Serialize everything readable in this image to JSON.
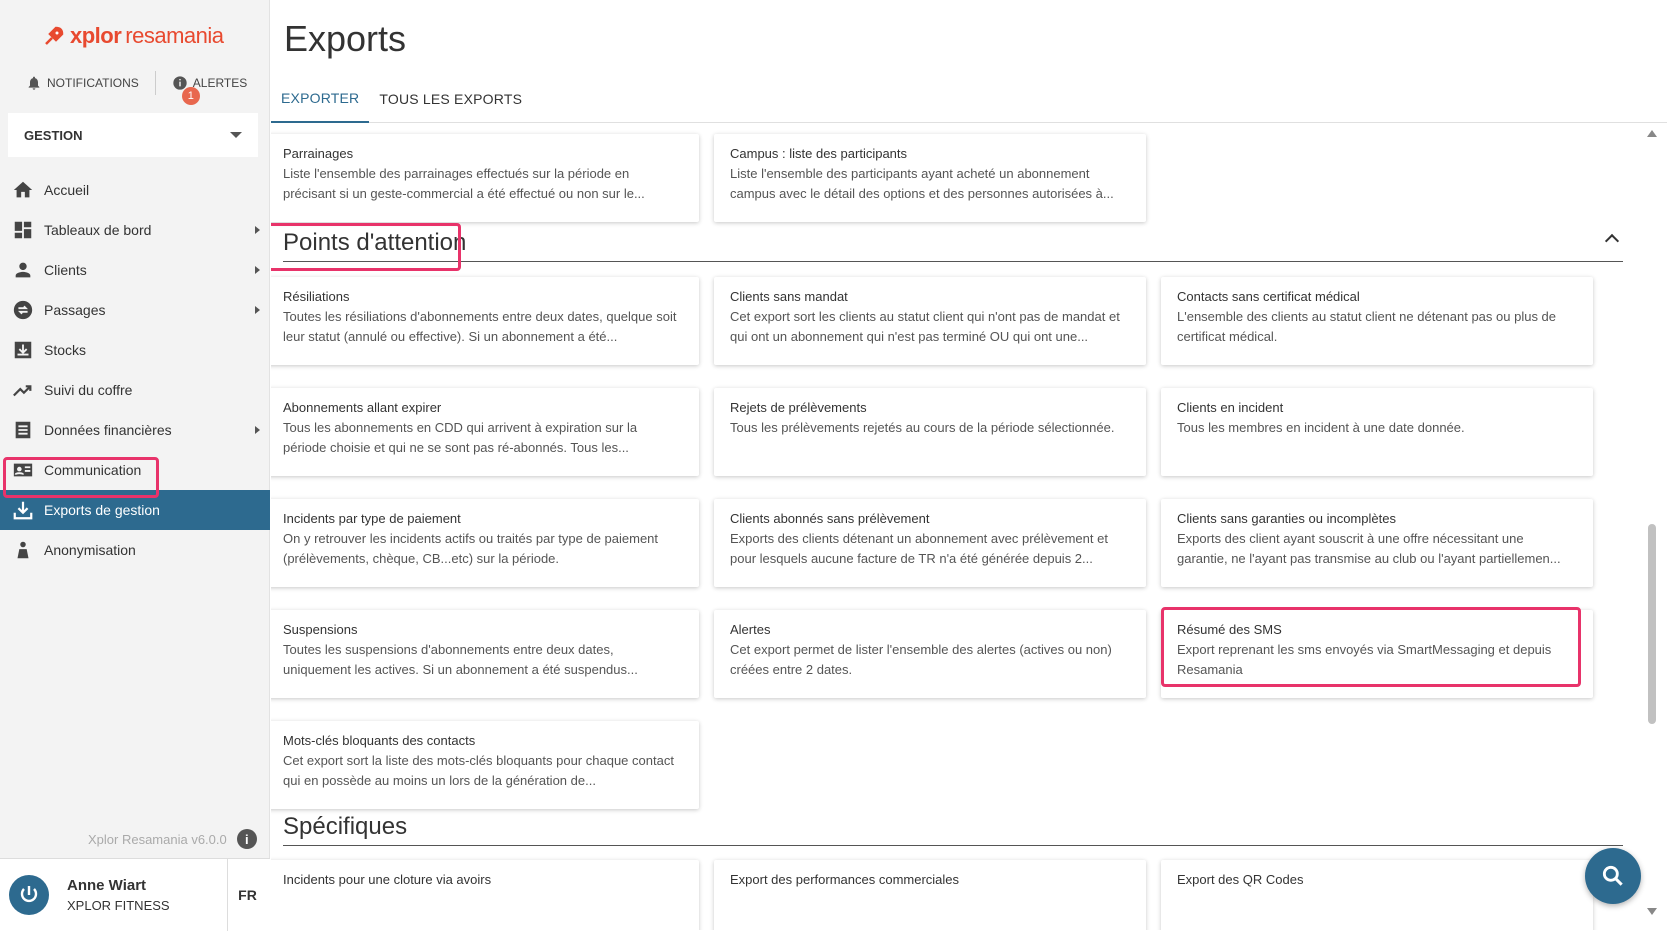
{
  "app": {
    "brand_prefix": "xplor",
    "brand_suffix": "resamania",
    "version": "Xplor Resamania v6.0.0"
  },
  "topbar": {
    "notifications_label": "NOTIFICATIONS",
    "alerts_label": "ALERTES",
    "alerts_count": "1"
  },
  "module_select": {
    "value": "GESTION"
  },
  "nav": {
    "items": [
      {
        "label": "Accueil",
        "icon": "home-icon",
        "has_children": false
      },
      {
        "label": "Tableaux de bord",
        "icon": "dashboard-icon",
        "has_children": true
      },
      {
        "label": "Clients",
        "icon": "person-icon",
        "has_children": true
      },
      {
        "label": "Passages",
        "icon": "swap-icon",
        "has_children": true
      },
      {
        "label": "Stocks",
        "icon": "box-icon",
        "has_children": false
      },
      {
        "label": "Suivi du coffre",
        "icon": "trend-icon",
        "has_children": false
      },
      {
        "label": "Données financières",
        "icon": "list-icon",
        "has_children": true
      },
      {
        "label": "Communication",
        "icon": "contact-card-icon",
        "has_children": false
      },
      {
        "label": "Exports de gestion",
        "icon": "download-icon",
        "has_children": false,
        "active": true
      },
      {
        "label": "Anonymisation",
        "icon": "incognito-icon",
        "has_children": false
      }
    ]
  },
  "user": {
    "name": "Anne Wiart",
    "org": "XPLOR FITNESS",
    "lang": "FR"
  },
  "page": {
    "title": "Exports",
    "tabs": [
      {
        "label": "EXPORTER",
        "active": true
      },
      {
        "label": "TOUS LES EXPORTS",
        "active": false
      }
    ]
  },
  "top_cards": [
    {
      "title": "Parrainages",
      "desc": "Liste l'ensemble des parrainages effectués sur la période en précisant si un geste-commercial a été effectué ou non sur le..."
    },
    {
      "title": "Campus : liste des participants",
      "desc": "Liste l'ensemble des participants ayant acheté un abonnement campus avec le détail des options et des personnes autorisées à..."
    }
  ],
  "sections": [
    {
      "title": "Points d'attention",
      "cards": [
        {
          "title": "Résiliations",
          "desc": "Toutes les résiliations d'abonnements entre deux dates, quelque soit leur statut (annulé ou effective). Si un abonnement a été..."
        },
        {
          "title": "Clients sans mandat",
          "desc": "Cet export sort les clients au statut client qui n'ont pas de mandat et qui ont un abonnement qui n'est pas terminé OU qui ont une..."
        },
        {
          "title": "Contacts sans certificat médical",
          "desc": "L'ensemble des clients au statut client ne détenant pas ou plus de certificat médical."
        },
        {
          "title": "Abonnements allant expirer",
          "desc": "Tous les abonnements en CDD qui arrivent à expiration sur la période choisie et qui ne se sont pas ré-abonnés. Tous les..."
        },
        {
          "title": "Rejets de prélèvements",
          "desc": "Tous les prélèvements rejetés au cours de la période sélectionnée."
        },
        {
          "title": "Clients en incident",
          "desc": "Tous les membres en incident à une date donnée."
        },
        {
          "title": "Incidents par type de paiement",
          "desc": "On y retrouver les incidents actifs ou traités par type de paiement (prélèvements, chèque, CB...etc) sur la période."
        },
        {
          "title": "Clients abonnés sans prélèvement",
          "desc": "Exports des clients détenant un abonnement avec prélèvement et pour lesquels aucune facture de TR n'a été générée depuis 2..."
        },
        {
          "title": "Clients sans garanties ou incomplètes",
          "desc": "Exports des client ayant souscrit à une offre nécessitant une garantie, ne l'ayant pas transmise au club ou l'ayant partiellemen..."
        },
        {
          "title": "Suspensions",
          "desc": "Toutes les suspensions d'abonnements entre deux dates, uniquement les actives. Si un abonnement a été suspendus..."
        },
        {
          "title": "Alertes",
          "desc": "Cet export permet de lister l'ensemble des alertes (actives ou non) créées entre 2 dates."
        },
        {
          "title": "Résumé des SMS",
          "desc": "Export reprenant les sms envoyés via SmartMessaging et depuis Resamania"
        },
        {
          "title": "Mots-clés bloquants des contacts",
          "desc": "Cet export sort la liste des mots-clés bloquants pour chaque contact qui en possède au moins un lors de la génération de..."
        }
      ]
    },
    {
      "title": "Spécifiques",
      "cards": [
        {
          "title": "Incidents pour une cloture via avoirs",
          "desc": ""
        },
        {
          "title": "Export des performances commerciales",
          "desc": ""
        },
        {
          "title": "Export des QR Codes",
          "desc": ""
        }
      ]
    }
  ],
  "colors": {
    "accent": "#2d6a8f",
    "brand": "#e8492f",
    "highlight": "#e8336a",
    "badge": "#e8674e"
  }
}
